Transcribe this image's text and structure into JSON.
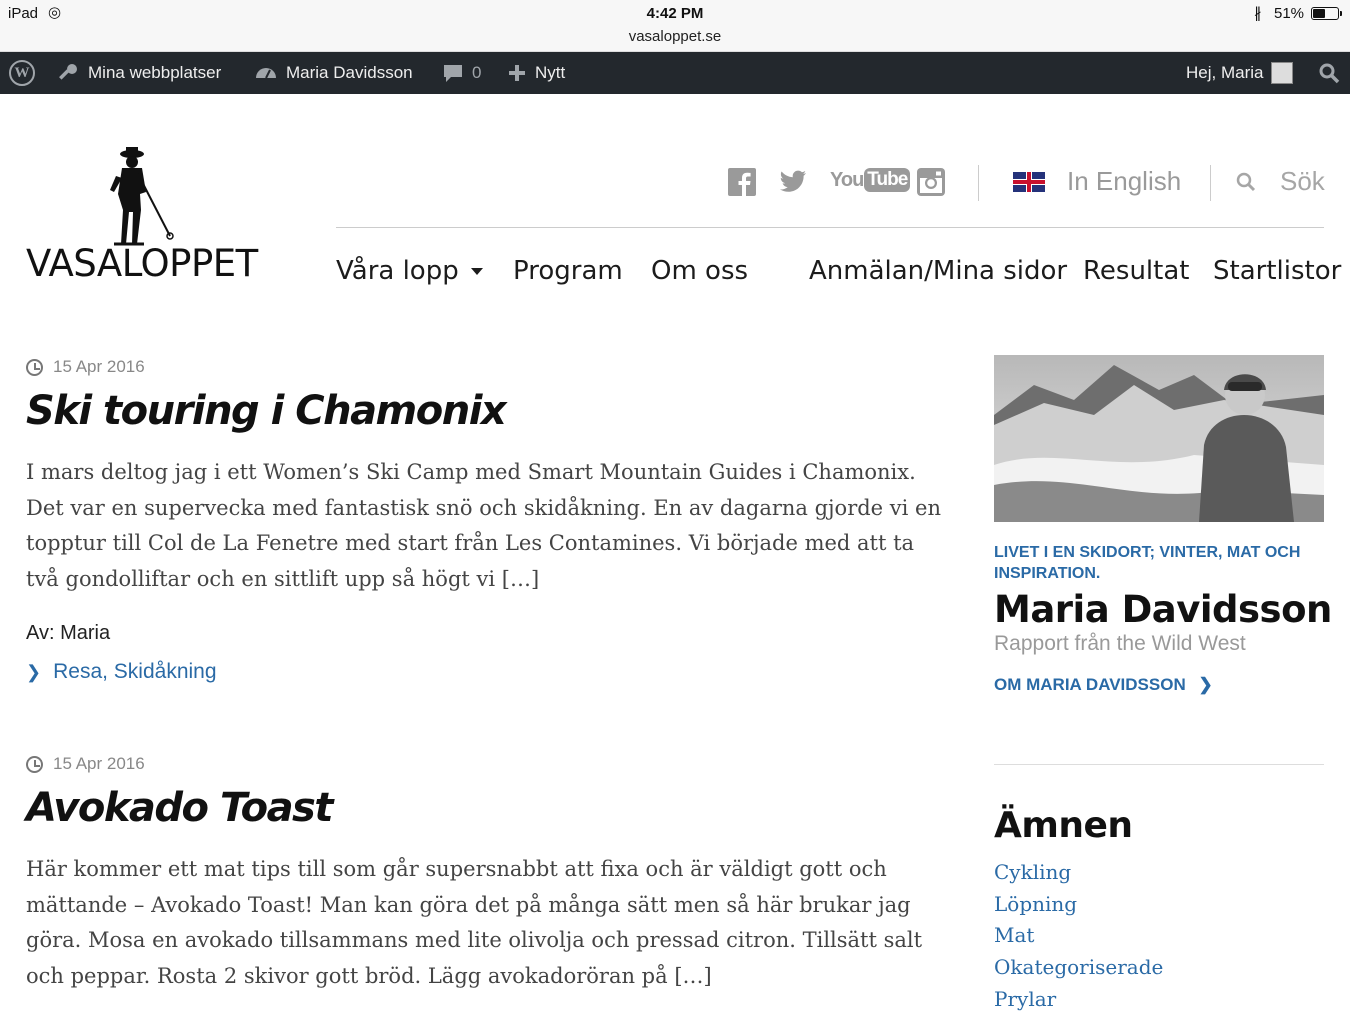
{
  "status_bar": {
    "device": "iPad",
    "time": "4:42 PM",
    "url": "vasaloppet.se",
    "battery": "51%",
    "battery_level": 0.51
  },
  "admin_bar": {
    "my_sites": "Mina webbplatser",
    "site_name": "Maria Davidsson",
    "comments_count": "0",
    "new_label": "Nytt",
    "greeting": "Hej, Maria"
  },
  "header": {
    "logo_text": "VASALOPPET",
    "social": [
      "facebook-icon",
      "twitter-icon",
      "youtube-icon",
      "instagram-icon"
    ],
    "youtube_text": "YouTube",
    "language_label": "In English",
    "search_label": "Sök",
    "nav": [
      "Våra lopp",
      "Program",
      "Om oss",
      "Anmälan/Mina sidor",
      "Resultat",
      "Startlistor"
    ]
  },
  "posts": [
    {
      "date": "15 Apr 2016",
      "title": "Ski touring i Chamonix",
      "excerpt": "I mars deltog jag i ett Women’s Ski Camp med Smart Mountain Guides i Chamonix. Det var en supervecka med fantastisk snö och skidåkning. En av dagarna gjorde vi en topptur till Col de La Fenetre med start från Les Contamines. Vi började med att ta två gondolliftar och en sittlift upp så högt vi […]",
      "author": "Av: Maria",
      "categories": [
        "Resa",
        "Skidåkning"
      ]
    },
    {
      "date": "15 Apr 2016",
      "title": "Avokado Toast",
      "excerpt": "Här kommer ett mat tips till som går supersnabbt att fixa och är väldigt gott och mättande – Avokado Toast! Man kan göra det på många sätt men så här brukar jag göra. Mosa en avokado tillsammans med lite olivolja och pressad citron. Tillsätt salt och peppar. Rosta 2 skivor gott bröd. Lägg avokadoröran på […]"
    }
  ],
  "sidebar": {
    "kicker": "LIVET I EN SKIDORT; VINTER, MAT OCH INSPIRATION.",
    "name": "Maria Davidsson",
    "subtitle": "Rapport från the Wild West",
    "about_link": "OM MARIA DAVIDSSON",
    "topics_heading": "Ämnen",
    "topics": [
      "Cykling",
      "Löpning",
      "Mat",
      "Okategoriserade",
      "Prylar"
    ]
  }
}
